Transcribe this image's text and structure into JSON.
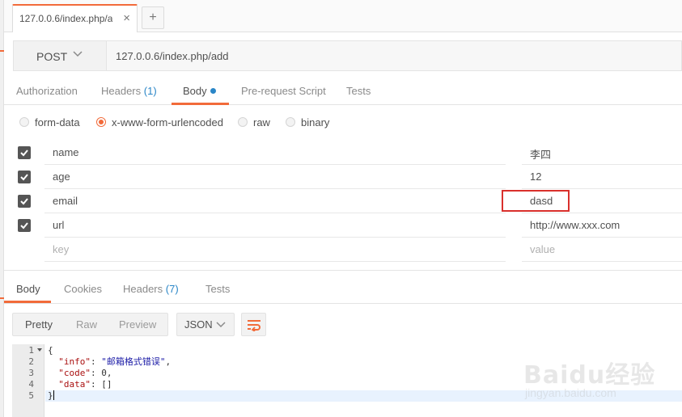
{
  "tab": {
    "title": "127.0.0.6/index.php/a",
    "close": "×",
    "new_tab": "+"
  },
  "request": {
    "method": "POST",
    "url": "127.0.0.6/index.php/add"
  },
  "request_tabs": [
    {
      "label": "Authorization"
    },
    {
      "label": "Headers",
      "count": "(1)"
    },
    {
      "label": "Body"
    },
    {
      "label": "Pre-request Script"
    },
    {
      "label": "Tests"
    }
  ],
  "body_modes": [
    "form-data",
    "x-www-form-urlencoded",
    "raw",
    "binary"
  ],
  "body_mode_selected": "x-www-form-urlencoded",
  "params": [
    {
      "key": "name",
      "value": "李四",
      "checked": true
    },
    {
      "key": "age",
      "value": "12",
      "checked": true
    },
    {
      "key": "email",
      "value": "dasd",
      "checked": true
    },
    {
      "key": "url",
      "value": "http://www.xxx.com",
      "checked": true
    }
  ],
  "new_param": {
    "key_placeholder": "key",
    "value_placeholder": "value"
  },
  "response_tabs": [
    {
      "label": "Body"
    },
    {
      "label": "Cookies"
    },
    {
      "label": "Headers",
      "count": "(7)"
    },
    {
      "label": "Tests"
    }
  ],
  "format_buttons": [
    "Pretty",
    "Raw",
    "Preview"
  ],
  "format_selected": "Pretty",
  "language": "JSON",
  "response_lines": {
    "numbers": [
      "1",
      "2",
      "3",
      "4",
      "5"
    ],
    "l1": "{",
    "l2_key": "\"info\"",
    "l2_val": "\"邮箱格式错误\"",
    "l3_key": "\"code\"",
    "l3_val": "0",
    "l4_key": "\"data\"",
    "l4_val": "[]",
    "l5": "}"
  },
  "watermark": {
    "brand": "Baidu经验",
    "site": "jingyan.baidu.com"
  },
  "colors": {
    "accent": "#f26b3a",
    "count_blue": "#2a86c7",
    "highlight_box": "#d9302c"
  },
  "icons": [
    "close-icon",
    "plus-icon",
    "chevron-down-icon",
    "checkbox-checked-icon",
    "wrap-lines-icon",
    "fold-arrow-icon"
  ]
}
